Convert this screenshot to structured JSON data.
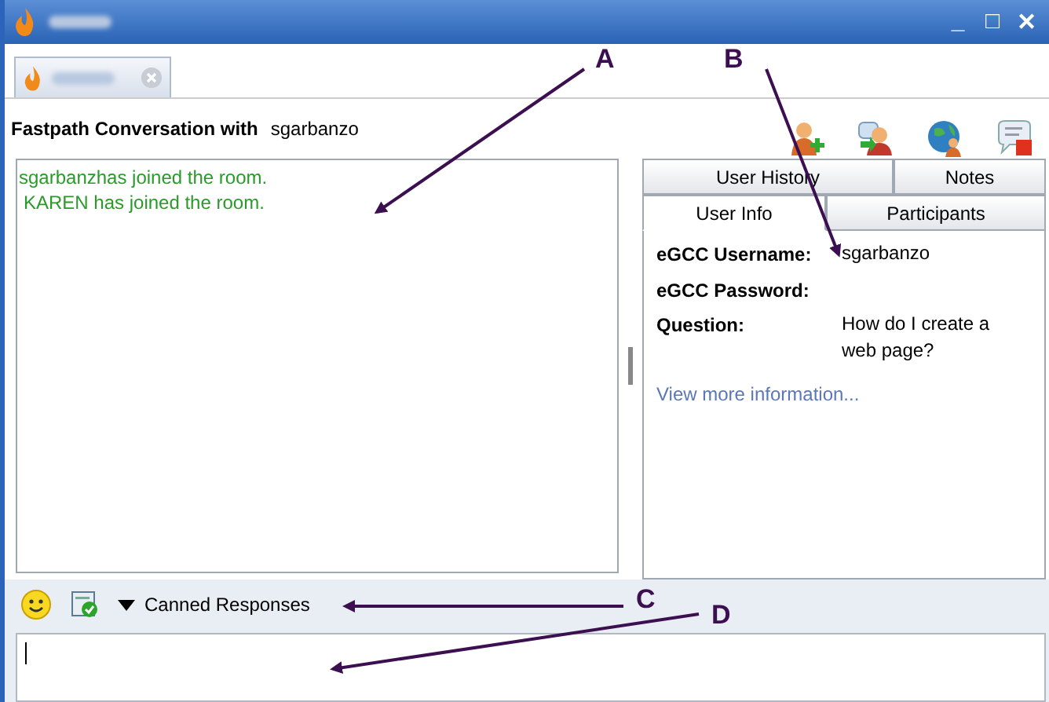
{
  "window": {
    "controls": [
      "_",
      "□",
      "✕"
    ]
  },
  "conversation": {
    "title": "Fastpath Conversation with",
    "customer": "sgarbanzo"
  },
  "toolbar_icons": [
    {
      "kind": "invite"
    },
    {
      "kind": "transfer"
    },
    {
      "kind": "conference"
    },
    {
      "kind": "end"
    }
  ],
  "chat": {
    "messages": [
      "sgarbanzhas joined the room.",
      "KAREN has joined the room."
    ]
  },
  "info_tabs": [
    [
      {
        "label": "User History",
        "selected": false
      },
      {
        "label": "Notes",
        "selected": false
      }
    ],
    [
      {
        "label": "User Info",
        "selected": true
      },
      {
        "label": "Participants",
        "selected": false
      }
    ]
  ],
  "user_info": {
    "fields": [
      {
        "label": "eGCC Username:",
        "value": "sgarbanzo"
      },
      {
        "label": "eGCC Password:"
      },
      {
        "label": "Question:",
        "value": "How do I create a web page?"
      }
    ],
    "link": "View more information..."
  },
  "compose": {
    "canned_responses": "Canned Responses"
  },
  "annotations": [
    {
      "label": "A"
    },
    {
      "label": "B"
    },
    {
      "label": "C"
    },
    {
      "label": "D"
    }
  ]
}
